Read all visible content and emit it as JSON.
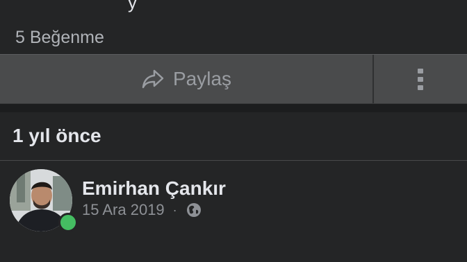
{
  "post": {
    "likes_text": "5 Beğenme",
    "share_label": "Paylaş",
    "time_header": "1 yıl önce"
  },
  "author": {
    "name": "Emirhan Çankır",
    "date": "15 Ara 2019",
    "separator": "·",
    "online": true
  },
  "icons": {
    "share": "share-arrow-icon",
    "more": "vertical-ellipsis-icon",
    "privacy": "globe-icon"
  },
  "colors": {
    "background": "#242526",
    "action_bar": "#4a4b4c",
    "online": "#45bd62"
  }
}
